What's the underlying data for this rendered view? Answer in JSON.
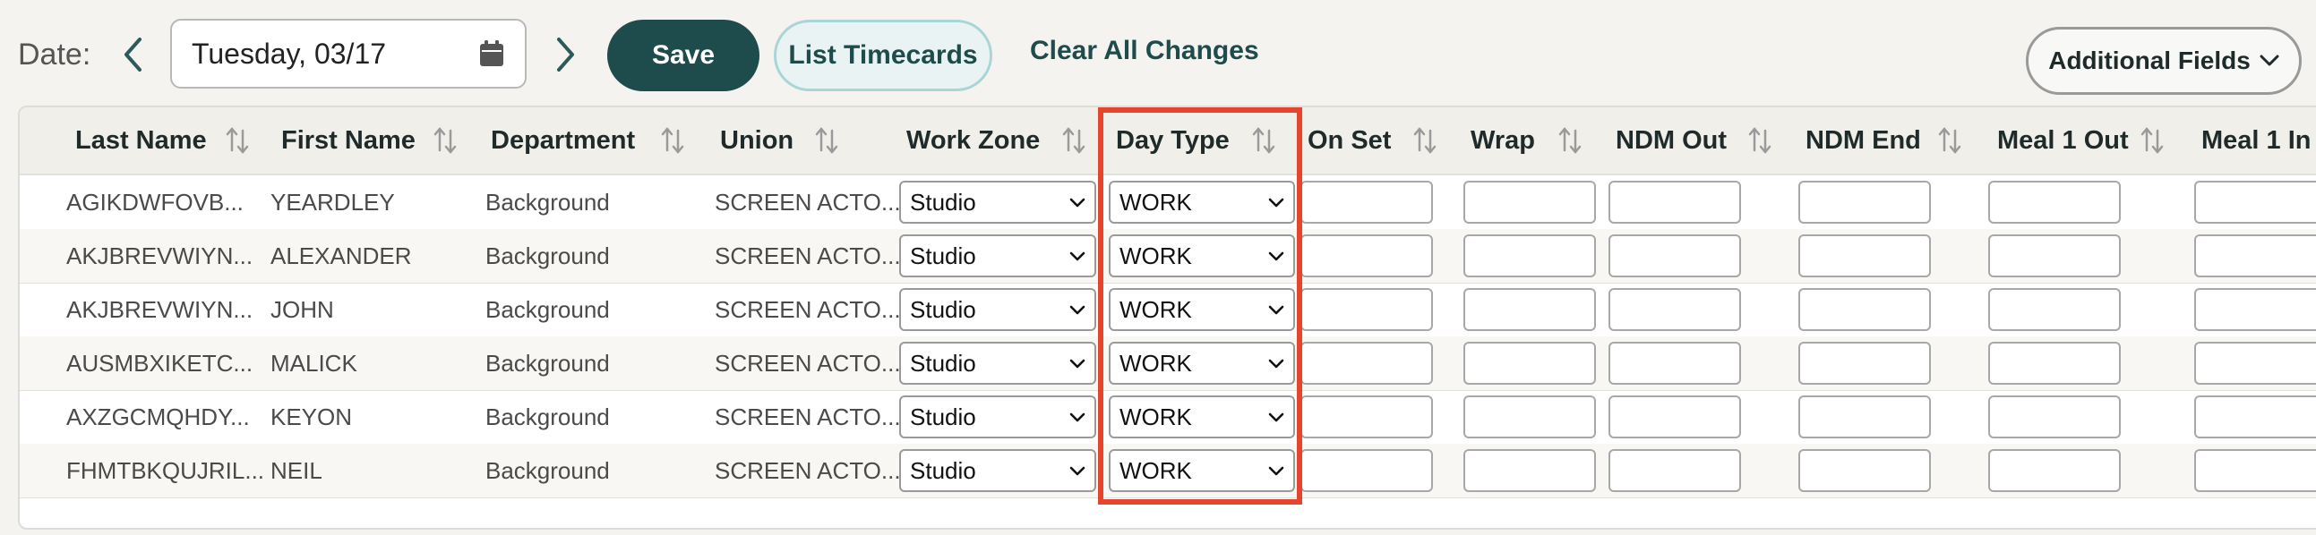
{
  "toolbar": {
    "date_label": "Date:",
    "date_value": "Tuesday, 03/17",
    "save_label": "Save",
    "list_timecards_label": "List Timecards",
    "clear_changes_label": "Clear All Changes",
    "additional_fields_label": "Additional Fields"
  },
  "columns": [
    "Last Name",
    "First Name",
    "Department",
    "Union",
    "Work Zone",
    "Day Type",
    "On Set",
    "Wrap",
    "NDM Out",
    "NDM End",
    "Meal 1 Out",
    "Meal 1 In"
  ],
  "rows": [
    {
      "last_name": "AGIKDWFOVB...",
      "first_name": "YEARDLEY",
      "department": "Background",
      "union": "SCREEN ACTO...",
      "work_zone": "Studio",
      "day_type": "WORK"
    },
    {
      "last_name": "AKJBREVWIYN...",
      "first_name": "ALEXANDER",
      "department": "Background",
      "union": "SCREEN ACTO...",
      "work_zone": "Studio",
      "day_type": "WORK"
    },
    {
      "last_name": "AKJBREVWIYN...",
      "first_name": "JOHN",
      "department": "Background",
      "union": "SCREEN ACTO...",
      "work_zone": "Studio",
      "day_type": "WORK"
    },
    {
      "last_name": "AUSMBXIKETC...",
      "first_name": "MALICK",
      "department": "Background",
      "union": "SCREEN ACTO...",
      "work_zone": "Studio",
      "day_type": "WORK"
    },
    {
      "last_name": "AXZGCMQHDY...",
      "first_name": "KEYON",
      "department": "Background",
      "union": "SCREEN ACTO...",
      "work_zone": "Studio",
      "day_type": "WORK"
    },
    {
      "last_name": "FHMTBKQUJRIL...",
      "first_name": "NEIL",
      "department": "Background",
      "union": "SCREEN ACTO...",
      "work_zone": "Studio",
      "day_type": "WORK"
    }
  ],
  "colors": {
    "accent": "#1e4b4b",
    "highlight": "#e4452c",
    "secondary_border": "#a9d5d6"
  }
}
